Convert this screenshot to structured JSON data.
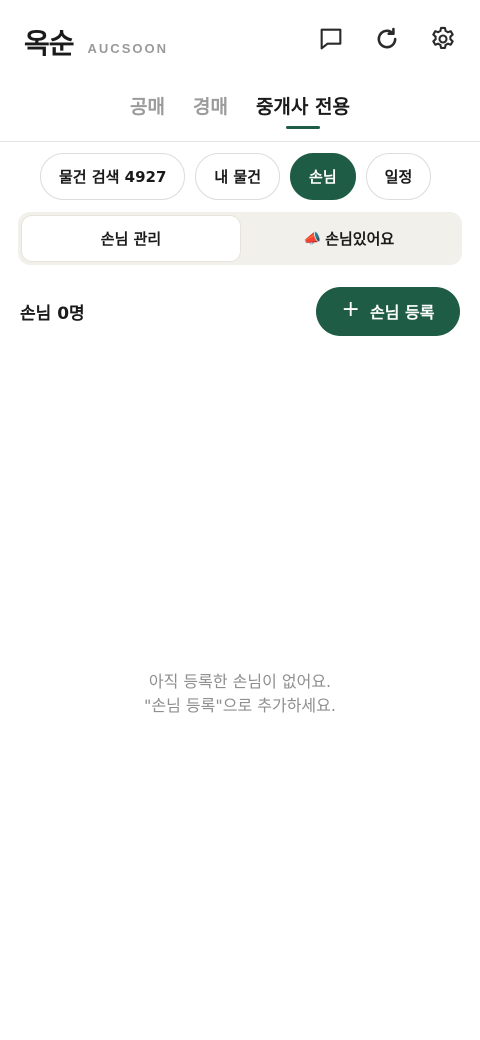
{
  "header": {
    "brand_name": "옥순",
    "brand_sub": "AUCSOON",
    "icons": [
      "chat-icon",
      "refresh-icon",
      "gear-icon"
    ]
  },
  "tabs": [
    {
      "label": "공매",
      "active": false
    },
    {
      "label": "경매",
      "active": false
    },
    {
      "label": "중개사 전용",
      "active": true
    }
  ],
  "chips": [
    {
      "label": "물건 검색 4927",
      "active": false
    },
    {
      "label": "내 물건",
      "active": false
    },
    {
      "label": "손님",
      "active": true
    },
    {
      "label": "일정",
      "active": false
    }
  ],
  "segment": {
    "left_label": "손님 관리",
    "right_emoji": "📣",
    "right_label": "손님있어요"
  },
  "list": {
    "count_label": "손님 0명",
    "add_plus": "+",
    "add_label": "손님 등록"
  },
  "empty": {
    "line1": "아직 등록한 손님이 없어요.",
    "line2": "\"손님 등록\"으로 추가하세요."
  },
  "colors": {
    "accent": "#1e5c46",
    "segment_bg": "#f2f0ea",
    "muted_text": "#8f8f8f"
  }
}
